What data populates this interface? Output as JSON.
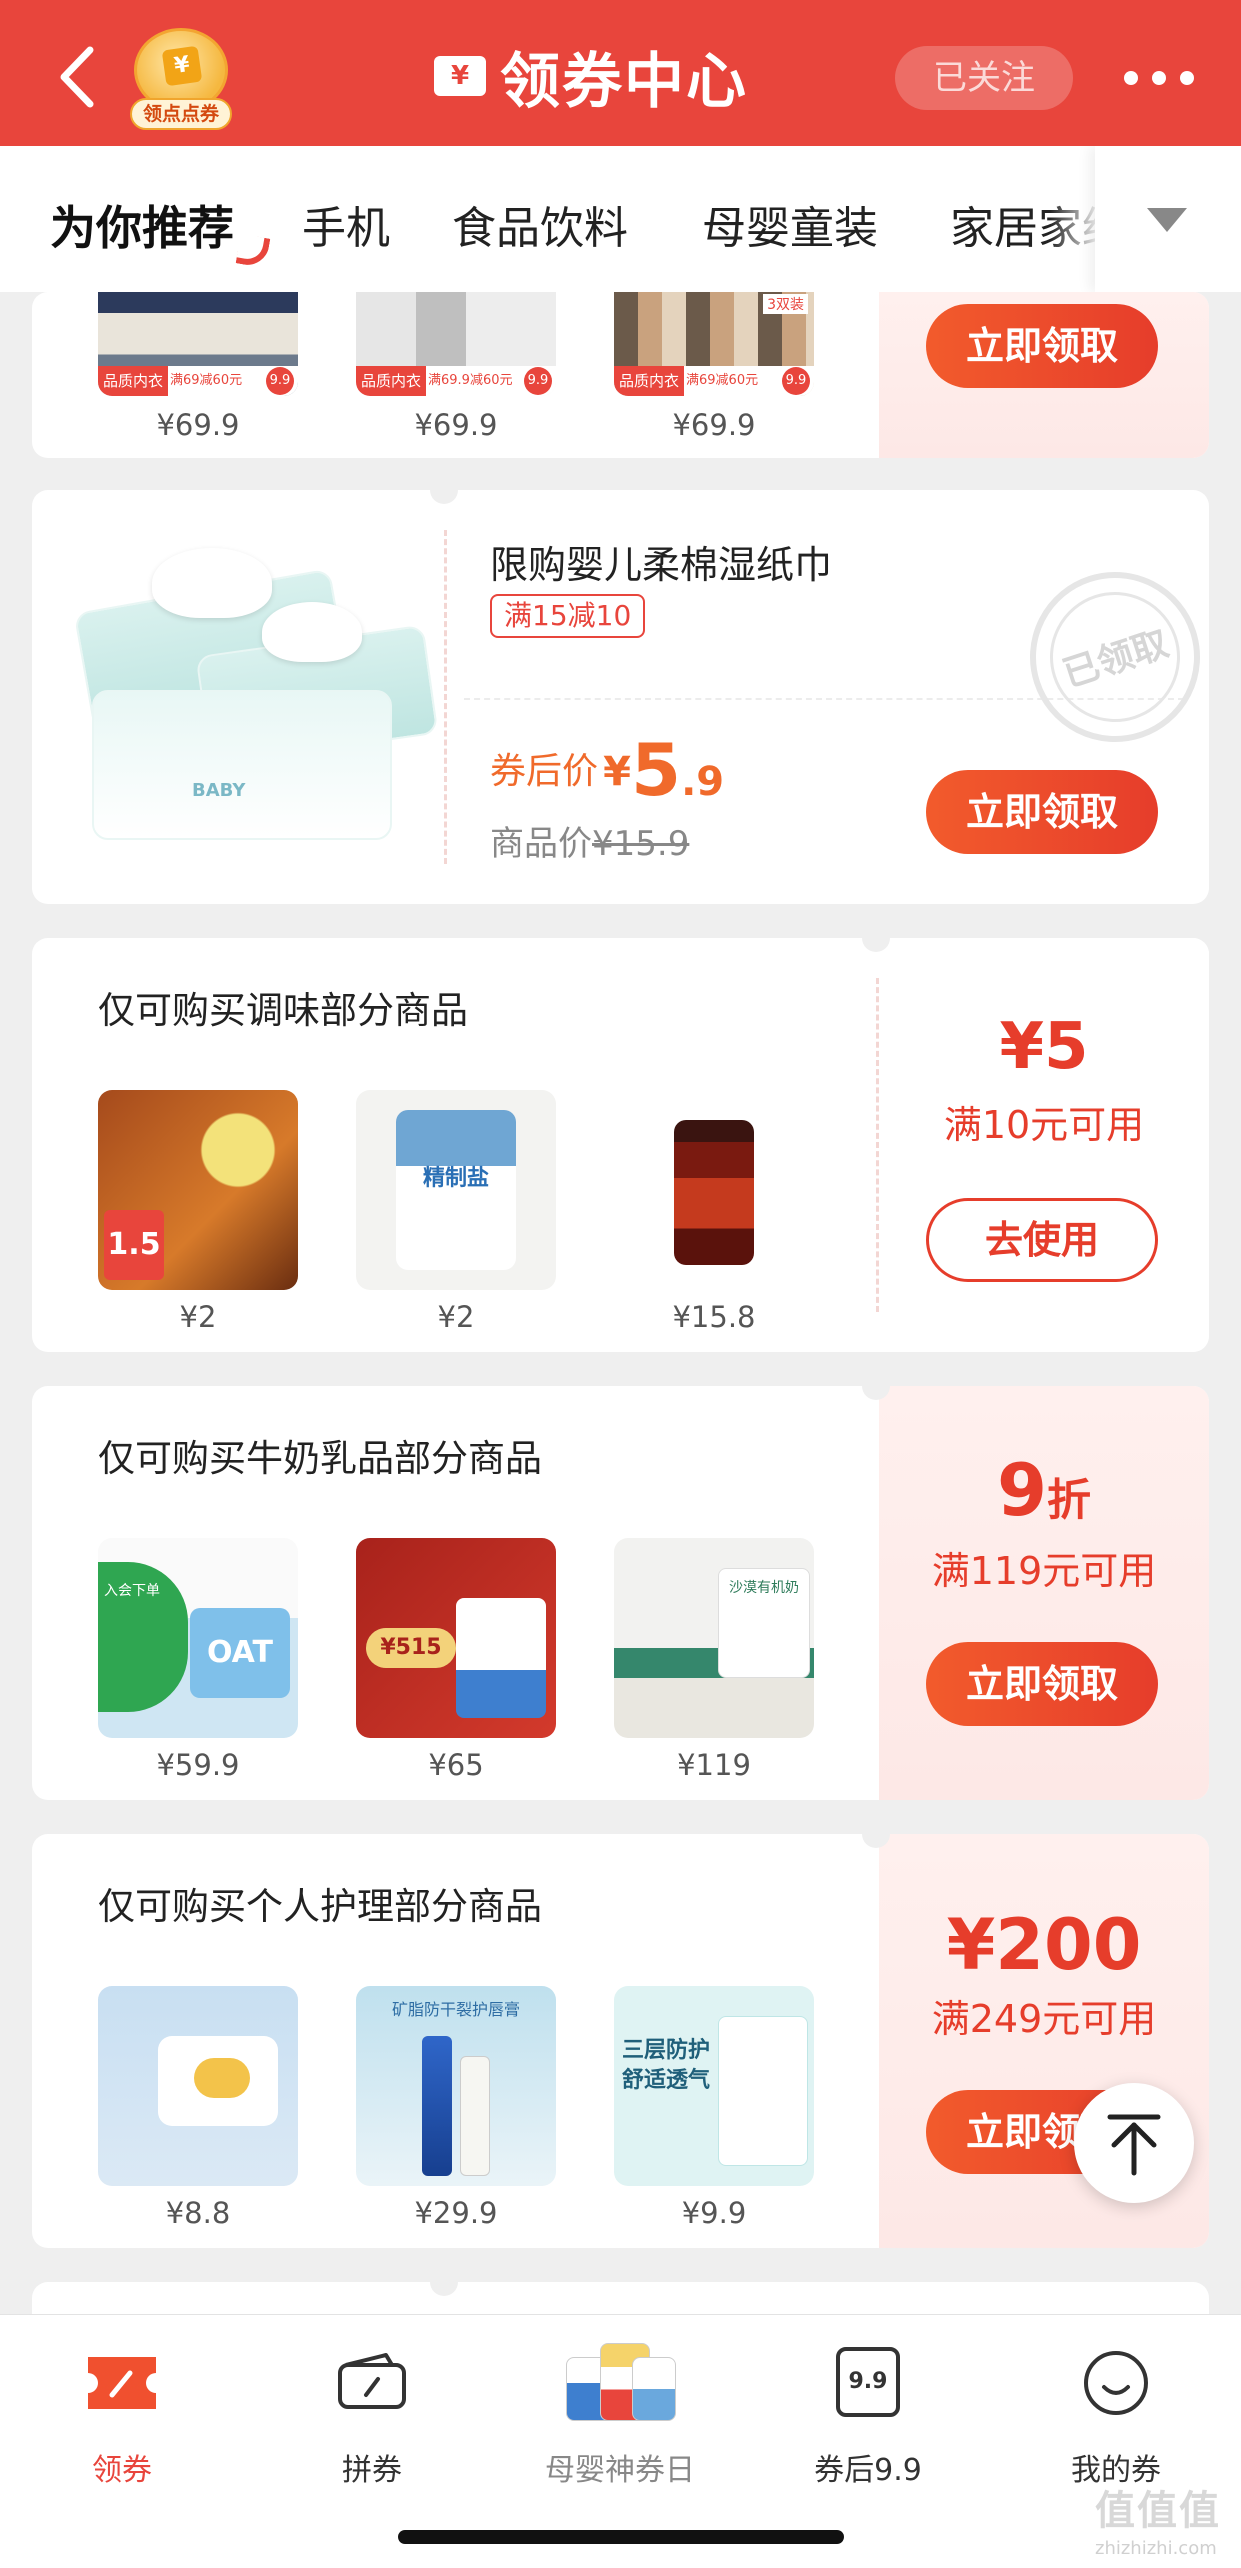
{
  "header": {
    "title": "领券中心",
    "title_icon": "¥",
    "mascot_label": "领点点券",
    "follow_label": "已关注"
  },
  "tabs": [
    "为你推荐",
    "手机",
    "食品饮料",
    "母婴童装",
    "家居家纺"
  ],
  "cards": {
    "socks": {
      "prices": [
        "¥69.9",
        "¥69.9",
        "¥69.9"
      ],
      "tag_label": "品质内衣",
      "tag_deals": [
        "满69减60元",
        "满69.9减60元",
        "满69减60元"
      ],
      "tag_price": "9.9",
      "pack_tag": "3双装",
      "button": "立即领取"
    },
    "wipes": {
      "title": "限购婴儿柔棉湿纸巾",
      "badge": "满15减10",
      "after_label": "券后价",
      "currency": "¥",
      "after_int": "5",
      "after_dec": ".9",
      "orig_label": "商品价",
      "orig_price": "¥15.9",
      "pack_text": "BABY",
      "button": "立即领取"
    },
    "seasoning": {
      "title": "仅可购买调味部分商品",
      "prices": [
        "¥2",
        "¥2",
        "¥15.8"
      ],
      "amount": "¥5",
      "condition": "满10元可用",
      "button": "去使用",
      "stamp": "已领取",
      "prod1_num": "1.5",
      "prod2_label": "精制盐"
    },
    "dairy": {
      "title": "仅可购买牛奶乳品部分商品",
      "prices": [
        "¥59.9",
        "¥65",
        "¥119"
      ],
      "amount_num": "9",
      "amount_unit": "折",
      "condition": "满119元可用",
      "button": "立即领取",
      "prod1_text": "入会下单",
      "prod2_text": "¥515",
      "prod3_text": "沙漠有机奶"
    },
    "care": {
      "title": "仅可购买个人护理部分商品",
      "prices": [
        "¥8.8",
        "¥29.9",
        "¥9.9"
      ],
      "amount": "¥200",
      "condition": "满249元可用",
      "button": "立即领取",
      "prod2_text": "矿脂防干裂护唇膏",
      "prod3_text": "三层防护 舒适透气"
    }
  },
  "bottom_nav": [
    {
      "label": "领券",
      "icon": "coupon-icon",
      "active": true
    },
    {
      "label": "拼券",
      "icon": "split-coupon-icon",
      "active": false
    },
    {
      "label": "母婴神券日",
      "icon": "milk-powder-icon",
      "active": false
    },
    {
      "label": "券后9.9",
      "icon": "price-tag-icon",
      "active": false
    },
    {
      "label": "我的券",
      "icon": "smile-icon",
      "active": false
    }
  ],
  "nav_99_badge": "9.9",
  "watermark": "值值值",
  "watermark_url": "zhizhizhi.com",
  "colors": {
    "brand_red": "#e8453c",
    "accent_orange": "#f25b2c",
    "page_bg": "#efefef"
  }
}
